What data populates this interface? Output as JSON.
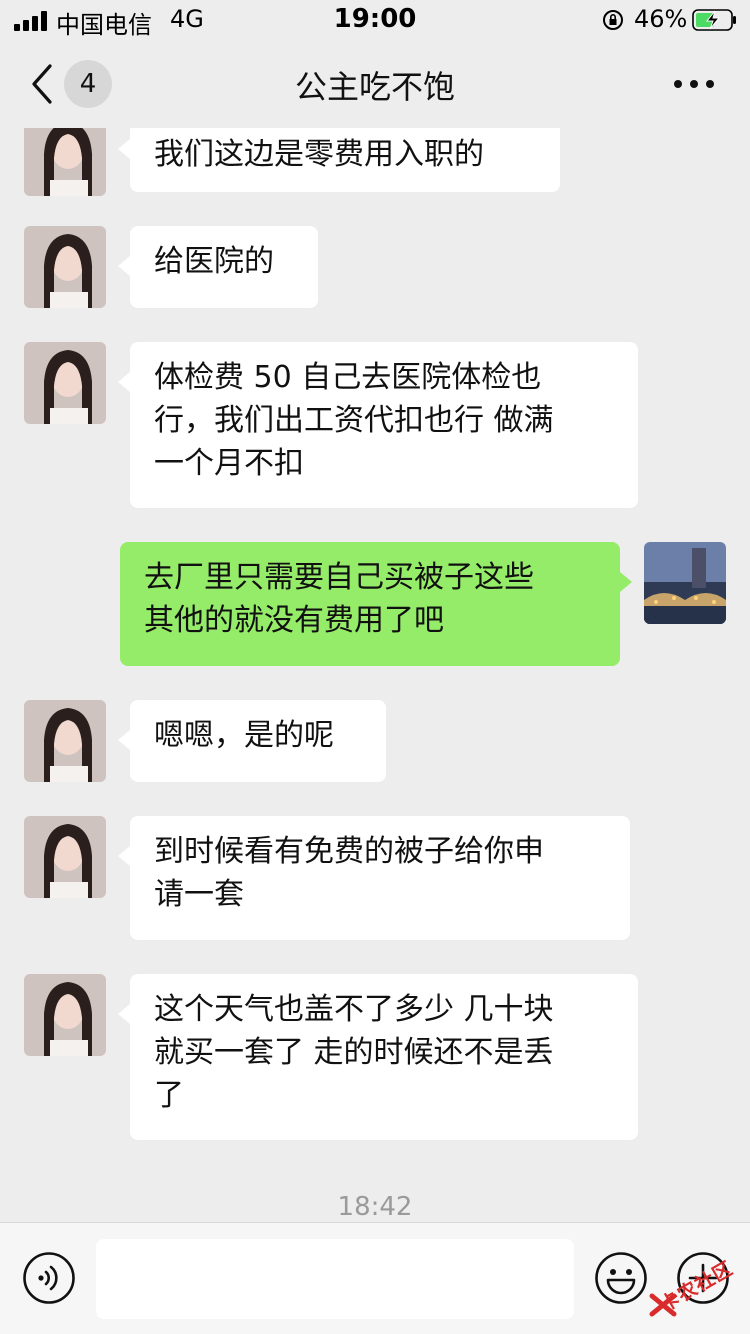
{
  "status_bar": {
    "carrier": "中国电信",
    "network": "4G",
    "time": "19:00",
    "battery": "46%"
  },
  "nav": {
    "unread_count": "4",
    "title": "公主吃不饱"
  },
  "messages": [
    {
      "side": "in",
      "text": "我们这边是零费用入职的"
    },
    {
      "side": "in",
      "text": "给医院的"
    },
    {
      "side": "in",
      "text": "体检费 50 自己去医院体检也\n行，我们出工资代扣也行 做满\n一个月不扣"
    },
    {
      "side": "out",
      "text": "去厂里只需要自己买被子这些\n其他的就没有费用了吧"
    },
    {
      "side": "in",
      "text": "嗯嗯，是的呢"
    },
    {
      "side": "in",
      "text": "到时候看有免费的被子给你申\n请一套"
    },
    {
      "side": "in",
      "text": "这个天气也盖不了多少 几十块\n就买一套了 走的时候还不是丢\n了"
    }
  ],
  "timestamp": "18:42",
  "input": {
    "value": ""
  },
  "watermark": "卡农社区",
  "colors": {
    "background": "#ededed",
    "incoming_bubble": "#ffffff",
    "outgoing_bubble": "#95ec69",
    "timestamp": "#9a9a9a"
  }
}
